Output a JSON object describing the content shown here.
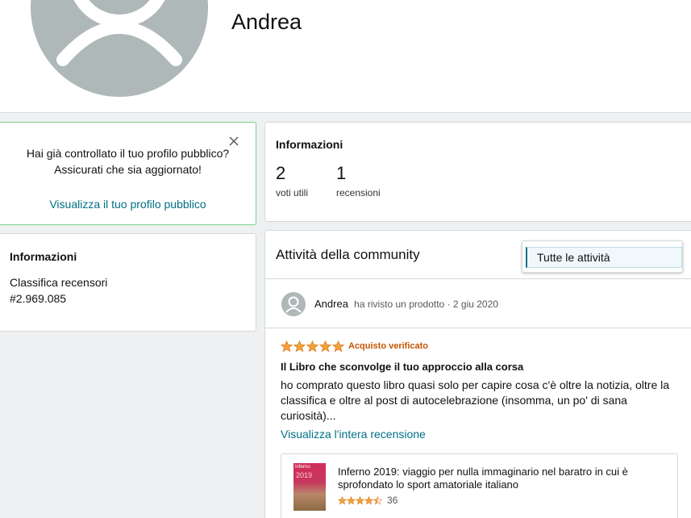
{
  "profile": {
    "name": "Andrea"
  },
  "nudge": {
    "text": "Hai già controllato il tuo profilo pubblico? Assicurati che sia aggiornato!",
    "link": "Visualizza il tuo profilo pubblico",
    "close_icon": "close-icon"
  },
  "info_left": {
    "title": "Informazioni",
    "rank_label": "Classifica recensori",
    "rank_value": "#2.969.085"
  },
  "info_right": {
    "title": "Informazioni",
    "stats": [
      {
        "value": "2",
        "label": "voti utili"
      },
      {
        "value": "1",
        "label": "recensioni"
      }
    ]
  },
  "community": {
    "title": "Attività della community",
    "filter_selected": "Tutte le attività",
    "activity": {
      "user": "Andrea",
      "action": "ha rivisto un prodotto",
      "date": "2 giu 2020"
    },
    "review": {
      "stars": 5,
      "verified": "Acquisto verificato",
      "title": "Il Libro che sconvolge il tuo approccio alla corsa",
      "body": "ho comprato questo libro quasi solo per capire cosa c'è oltre la notizia, oltre la classifica e oltre al post di autocelebrazione (insomma, un po' di sana curiosità)...",
      "link": "Visualizza l'intera recensione"
    },
    "product": {
      "title": "Inferno 2019: viaggio per nulla immaginario nel baratro in cui è sprofondato lo sport amatoriale italiano",
      "rating": 4.5,
      "rating_count": "36",
      "cover_title": "Inferno",
      "cover_year": "2019"
    }
  },
  "colors": {
    "link": "#007185",
    "star": "#de7921",
    "verified": "#c45500",
    "avatar_bg": "#afb8b8"
  }
}
